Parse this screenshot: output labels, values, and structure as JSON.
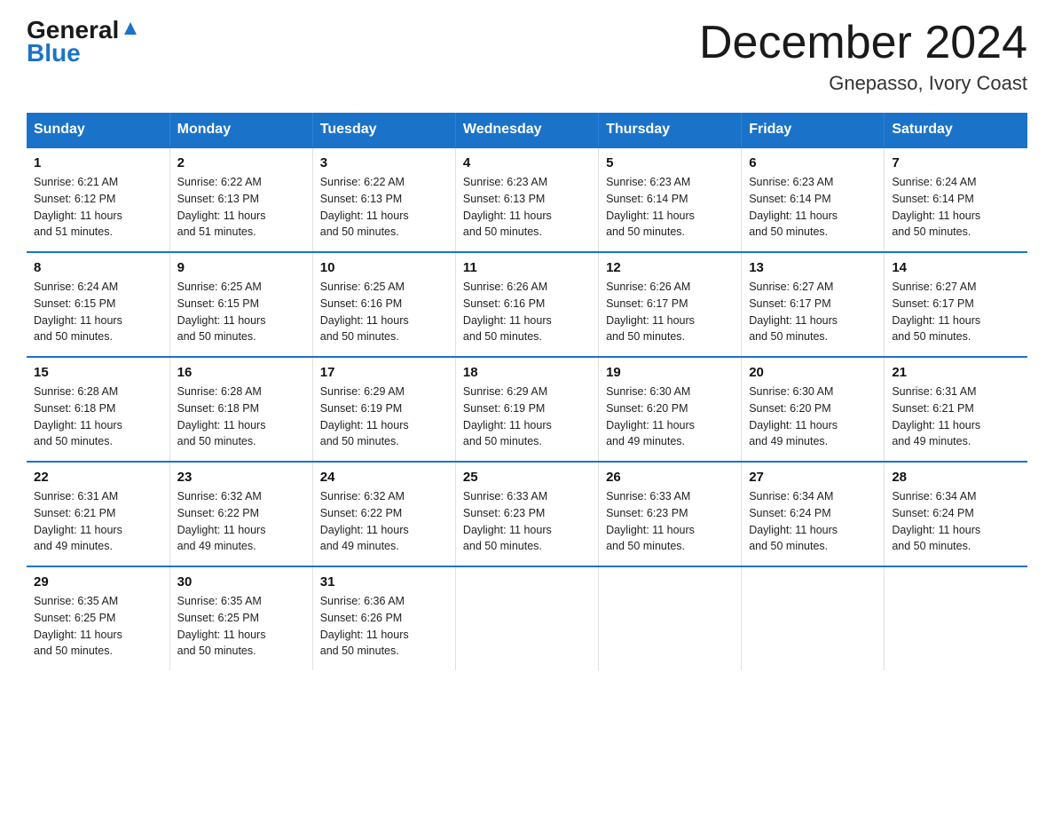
{
  "logo": {
    "line1": "General",
    "line2": "Blue"
  },
  "title": "December 2024",
  "subtitle": "Gnepasso, Ivory Coast",
  "days_of_week": [
    "Sunday",
    "Monday",
    "Tuesday",
    "Wednesday",
    "Thursday",
    "Friday",
    "Saturday"
  ],
  "weeks": [
    [
      {
        "day": "1",
        "sunrise": "6:21 AM",
        "sunset": "6:12 PM",
        "daylight": "11 hours and 51 minutes."
      },
      {
        "day": "2",
        "sunrise": "6:22 AM",
        "sunset": "6:13 PM",
        "daylight": "11 hours and 51 minutes."
      },
      {
        "day": "3",
        "sunrise": "6:22 AM",
        "sunset": "6:13 PM",
        "daylight": "11 hours and 50 minutes."
      },
      {
        "day": "4",
        "sunrise": "6:23 AM",
        "sunset": "6:13 PM",
        "daylight": "11 hours and 50 minutes."
      },
      {
        "day": "5",
        "sunrise": "6:23 AM",
        "sunset": "6:14 PM",
        "daylight": "11 hours and 50 minutes."
      },
      {
        "day": "6",
        "sunrise": "6:23 AM",
        "sunset": "6:14 PM",
        "daylight": "11 hours and 50 minutes."
      },
      {
        "day": "7",
        "sunrise": "6:24 AM",
        "sunset": "6:14 PM",
        "daylight": "11 hours and 50 minutes."
      }
    ],
    [
      {
        "day": "8",
        "sunrise": "6:24 AM",
        "sunset": "6:15 PM",
        "daylight": "11 hours and 50 minutes."
      },
      {
        "day": "9",
        "sunrise": "6:25 AM",
        "sunset": "6:15 PM",
        "daylight": "11 hours and 50 minutes."
      },
      {
        "day": "10",
        "sunrise": "6:25 AM",
        "sunset": "6:16 PM",
        "daylight": "11 hours and 50 minutes."
      },
      {
        "day": "11",
        "sunrise": "6:26 AM",
        "sunset": "6:16 PM",
        "daylight": "11 hours and 50 minutes."
      },
      {
        "day": "12",
        "sunrise": "6:26 AM",
        "sunset": "6:17 PM",
        "daylight": "11 hours and 50 minutes."
      },
      {
        "day": "13",
        "sunrise": "6:27 AM",
        "sunset": "6:17 PM",
        "daylight": "11 hours and 50 minutes."
      },
      {
        "day": "14",
        "sunrise": "6:27 AM",
        "sunset": "6:17 PM",
        "daylight": "11 hours and 50 minutes."
      }
    ],
    [
      {
        "day": "15",
        "sunrise": "6:28 AM",
        "sunset": "6:18 PM",
        "daylight": "11 hours and 50 minutes."
      },
      {
        "day": "16",
        "sunrise": "6:28 AM",
        "sunset": "6:18 PM",
        "daylight": "11 hours and 50 minutes."
      },
      {
        "day": "17",
        "sunrise": "6:29 AM",
        "sunset": "6:19 PM",
        "daylight": "11 hours and 50 minutes."
      },
      {
        "day": "18",
        "sunrise": "6:29 AM",
        "sunset": "6:19 PM",
        "daylight": "11 hours and 50 minutes."
      },
      {
        "day": "19",
        "sunrise": "6:30 AM",
        "sunset": "6:20 PM",
        "daylight": "11 hours and 49 minutes."
      },
      {
        "day": "20",
        "sunrise": "6:30 AM",
        "sunset": "6:20 PM",
        "daylight": "11 hours and 49 minutes."
      },
      {
        "day": "21",
        "sunrise": "6:31 AM",
        "sunset": "6:21 PM",
        "daylight": "11 hours and 49 minutes."
      }
    ],
    [
      {
        "day": "22",
        "sunrise": "6:31 AM",
        "sunset": "6:21 PM",
        "daylight": "11 hours and 49 minutes."
      },
      {
        "day": "23",
        "sunrise": "6:32 AM",
        "sunset": "6:22 PM",
        "daylight": "11 hours and 49 minutes."
      },
      {
        "day": "24",
        "sunrise": "6:32 AM",
        "sunset": "6:22 PM",
        "daylight": "11 hours and 49 minutes."
      },
      {
        "day": "25",
        "sunrise": "6:33 AM",
        "sunset": "6:23 PM",
        "daylight": "11 hours and 50 minutes."
      },
      {
        "day": "26",
        "sunrise": "6:33 AM",
        "sunset": "6:23 PM",
        "daylight": "11 hours and 50 minutes."
      },
      {
        "day": "27",
        "sunrise": "6:34 AM",
        "sunset": "6:24 PM",
        "daylight": "11 hours and 50 minutes."
      },
      {
        "day": "28",
        "sunrise": "6:34 AM",
        "sunset": "6:24 PM",
        "daylight": "11 hours and 50 minutes."
      }
    ],
    [
      {
        "day": "29",
        "sunrise": "6:35 AM",
        "sunset": "6:25 PM",
        "daylight": "11 hours and 50 minutes."
      },
      {
        "day": "30",
        "sunrise": "6:35 AM",
        "sunset": "6:25 PM",
        "daylight": "11 hours and 50 minutes."
      },
      {
        "day": "31",
        "sunrise": "6:36 AM",
        "sunset": "6:26 PM",
        "daylight": "11 hours and 50 minutes."
      },
      null,
      null,
      null,
      null
    ]
  ],
  "labels": {
    "sunrise": "Sunrise:",
    "sunset": "Sunset:",
    "daylight": "Daylight:"
  }
}
